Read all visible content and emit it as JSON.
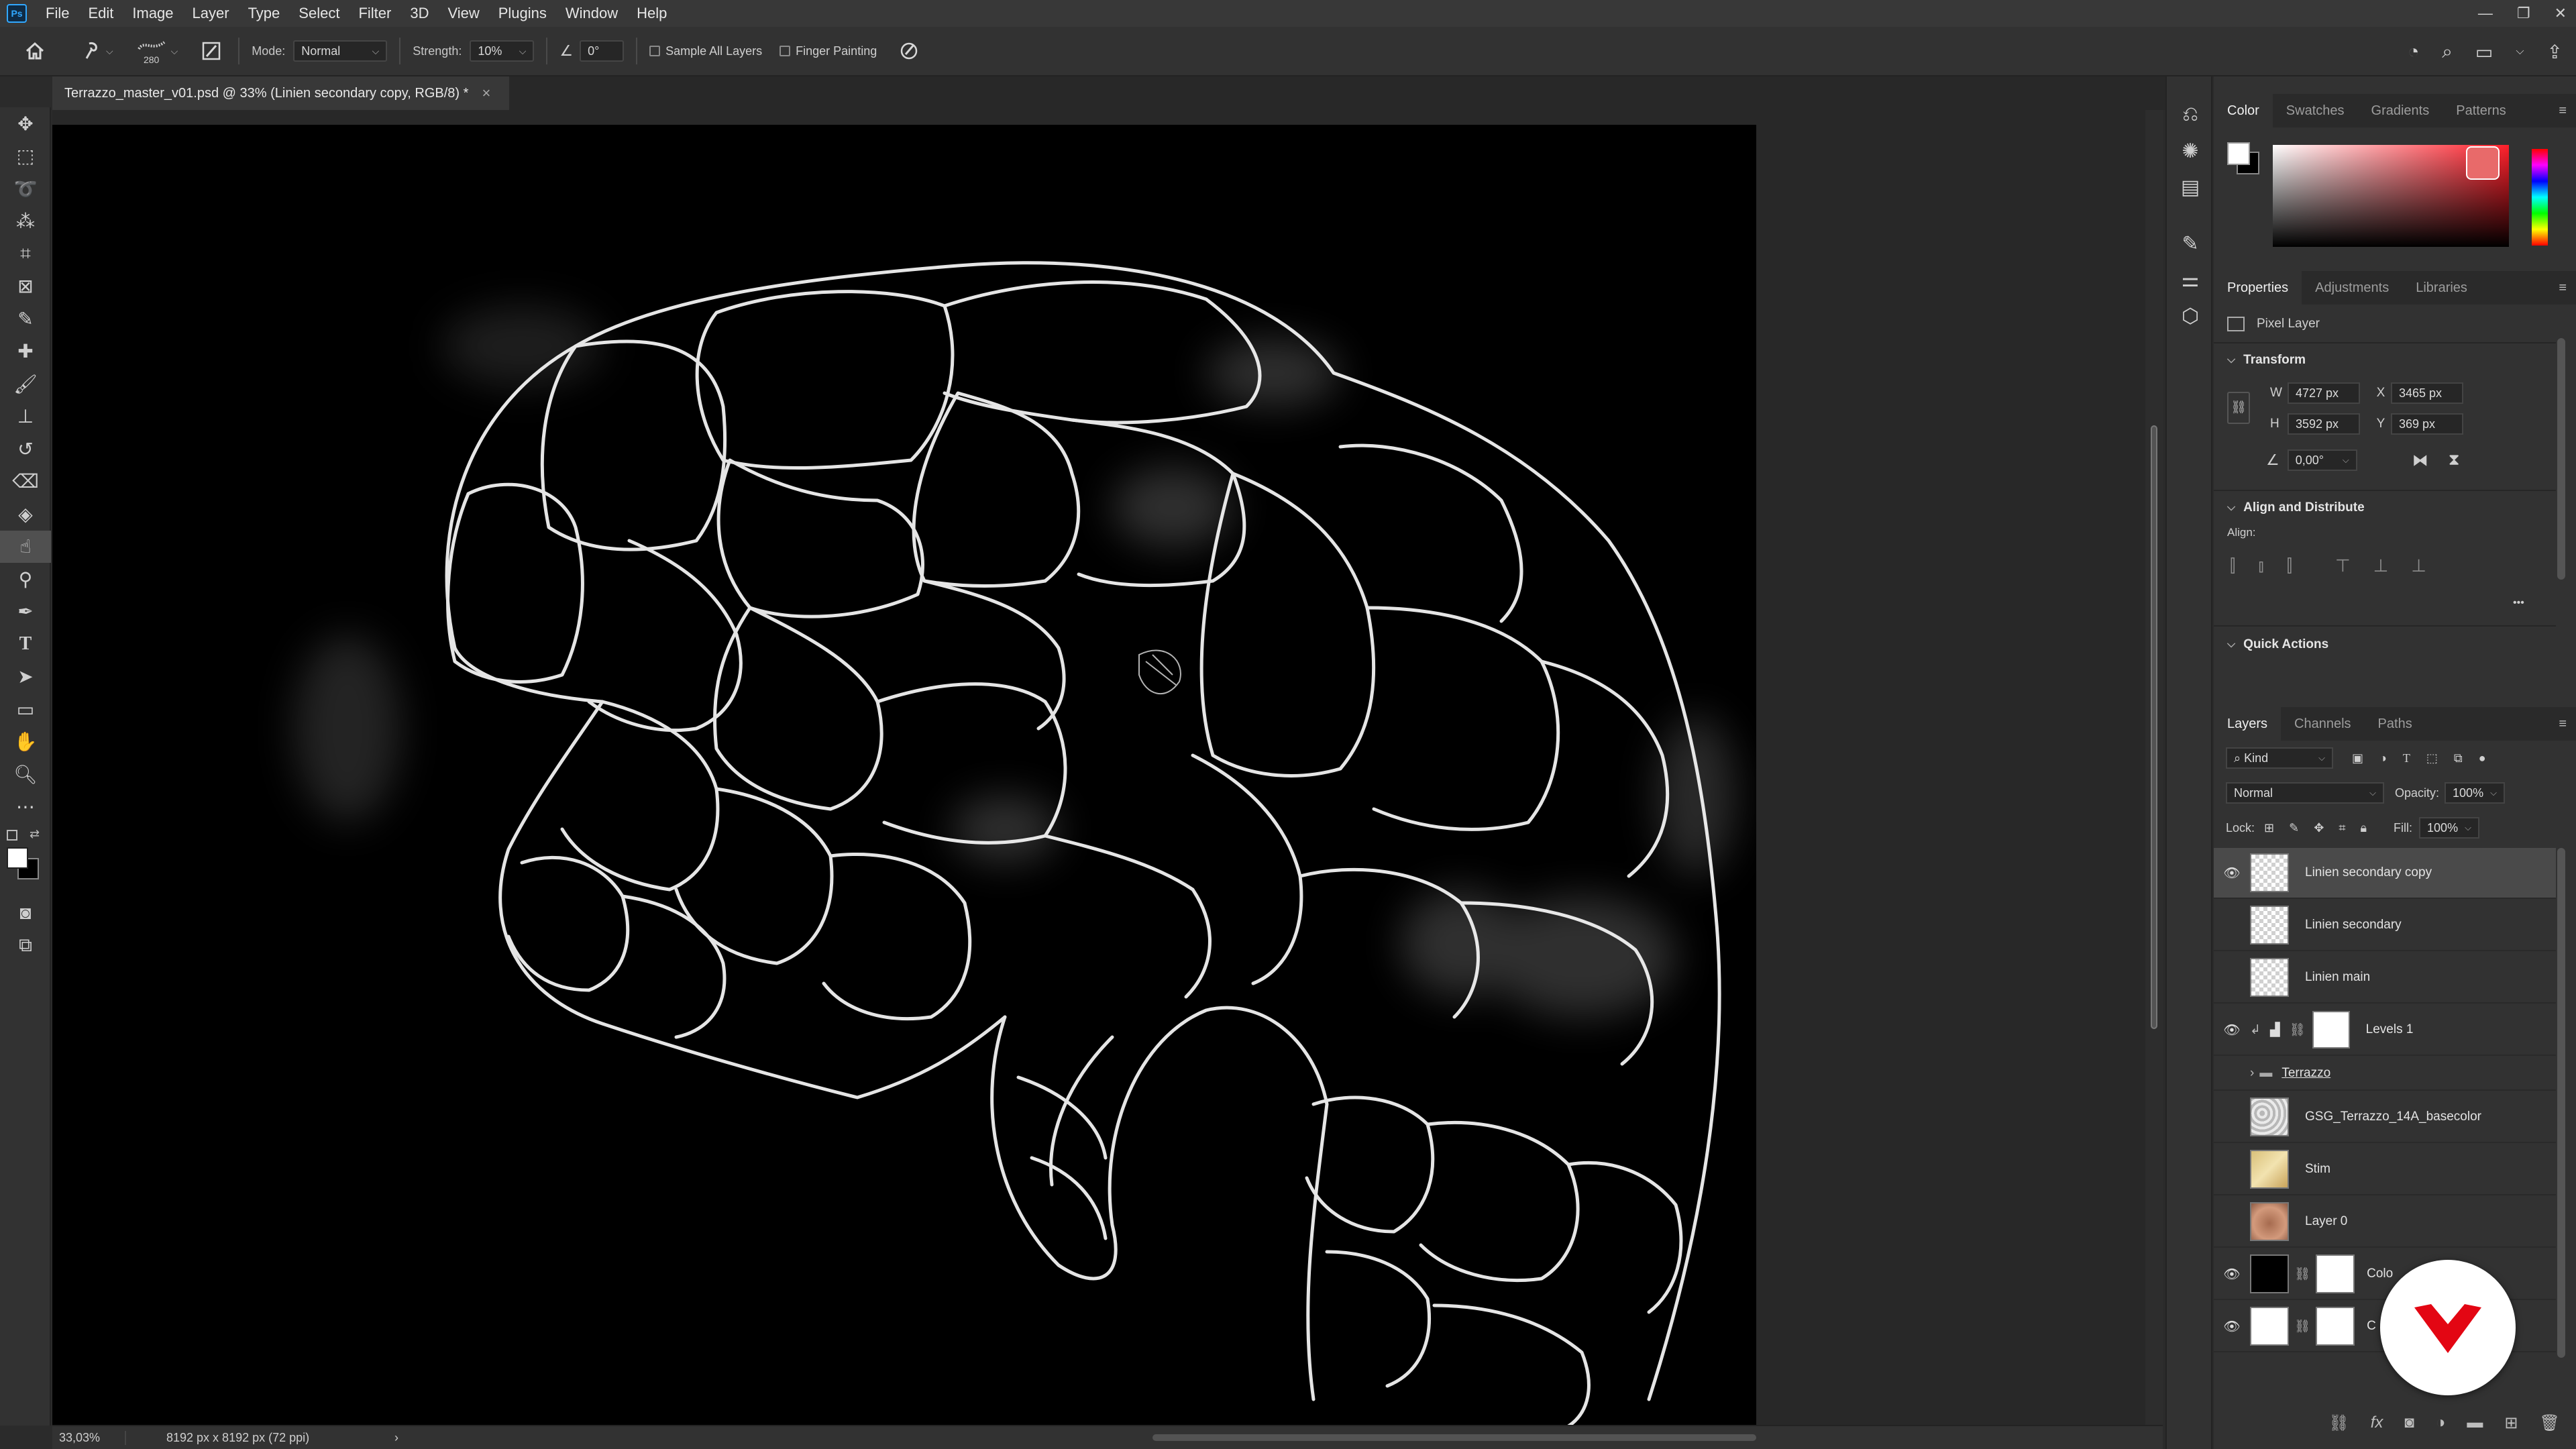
{
  "app": {
    "logo": "Ps",
    "menu": [
      "File",
      "Edit",
      "Image",
      "Layer",
      "Type",
      "Select",
      "Filter",
      "3D",
      "View",
      "Plugins",
      "Window",
      "Help"
    ],
    "window_controls": [
      "—",
      "❐",
      "✕"
    ]
  },
  "options_bar": {
    "brush_size": "280",
    "mode_label": "Mode:",
    "mode_value": "Normal",
    "strength_label": "Strength:",
    "strength_value": "10%",
    "angle_value": "0°",
    "sample_all_layers": "Sample All Layers",
    "finger_painting": "Finger Painting"
  },
  "document": {
    "tab_title": "Terrazzo_master_v01.psd @ 33% (Linien secondary copy, RGB/8) *",
    "close": "×"
  },
  "status": {
    "zoom": "33,03%",
    "doc_size": "8192 px x 8192 px (72 ppi)",
    "arrow": "›"
  },
  "color_panel": {
    "tabs": [
      "Color",
      "Swatches",
      "Gradients",
      "Patterns"
    ],
    "foreground": "#ffffff",
    "background": "#000000"
  },
  "properties_panel": {
    "tabs": [
      "Properties",
      "Adjustments",
      "Libraries"
    ],
    "layer_type": "Pixel Layer",
    "transform_title": "Transform",
    "w_label": "W",
    "w_value": "4727 px",
    "h_label": "H",
    "h_value": "3592 px",
    "x_label": "X",
    "x_value": "3465 px",
    "y_label": "Y",
    "y_value": "369 px",
    "angle_value": "0,00°",
    "align_title": "Align and Distribute",
    "align_label": "Align:",
    "more": "•••",
    "quick_actions_title": "Quick Actions"
  },
  "layers_panel": {
    "tabs": [
      "Layers",
      "Channels",
      "Paths"
    ],
    "filter_label": "Kind",
    "blend_mode": "Normal",
    "opacity_label": "Opacity:",
    "opacity_value": "100%",
    "lock_label": "Lock:",
    "fill_label": "Fill:",
    "fill_value": "100%",
    "layers": [
      {
        "name": "Linien secondary copy",
        "visible": true,
        "selected": true
      },
      {
        "name": "Linien secondary",
        "visible": false
      },
      {
        "name": "Linien main",
        "visible": false
      },
      {
        "name": "Levels 1",
        "visible": true
      },
      {
        "name": "Terrazzo",
        "visible": false
      },
      {
        "name": "GSG_Terrazzo_14A_basecolor",
        "visible": false
      },
      {
        "name": "Stim",
        "visible": false
      },
      {
        "name": "Layer 0",
        "visible": false
      },
      {
        "name": "Colo",
        "visible": true
      },
      {
        "name": "C",
        "visible": true
      }
    ],
    "bottom_icons": [
      "link-icon",
      "fx-icon",
      "mask-icon",
      "adjustment-icon",
      "group-icon",
      "new-layer-icon",
      "trash-icon"
    ]
  }
}
